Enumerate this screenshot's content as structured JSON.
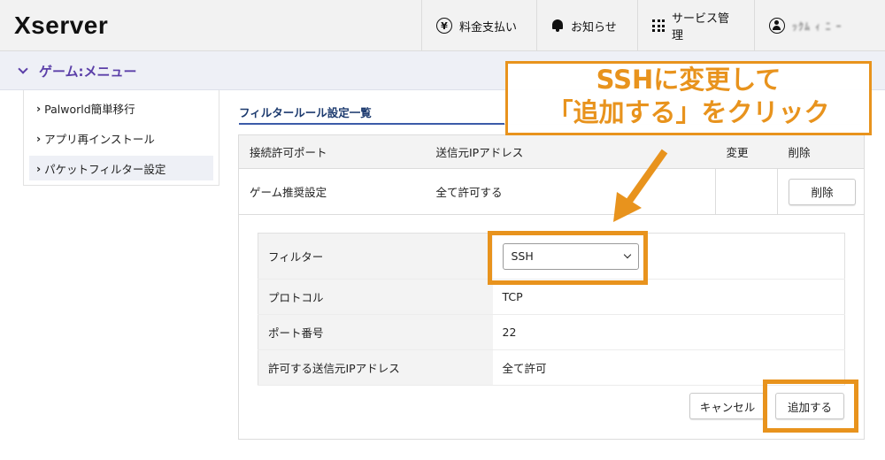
{
  "header": {
    "logo": "Xserver",
    "nav": [
      {
        "label": "料金支払い",
        "icon": "yen-icon"
      },
      {
        "label": "お知らせ",
        "icon": "bell-icon"
      },
      {
        "label": "サービス管理",
        "icon": "grid-icon"
      },
      {
        "label": "ｯｸﾑ ｨ ﾆ ｰ",
        "icon": "user-icon"
      }
    ]
  },
  "menubar": {
    "title": "ゲーム:メニュー"
  },
  "sidebar": {
    "items": [
      {
        "label": "Palworld簡単移行"
      },
      {
        "label": "アプリ再インストール"
      },
      {
        "label": "パケットフィルター設定",
        "active": true
      }
    ]
  },
  "content": {
    "title": "フィルタールール設定一覧",
    "table": {
      "headers": [
        "接続許可ポート",
        "送信元IPアドレス",
        "変更",
        "削除"
      ],
      "rows": [
        {
          "port": "ゲーム推奨設定",
          "source": "全て許可する",
          "delete_label": "削除"
        }
      ]
    },
    "form": {
      "filter_label": "フィルター",
      "filter_value": "SSH",
      "protocol_label": "プロトコル",
      "protocol_value": "TCP",
      "port_label": "ポート番号",
      "port_value": "22",
      "source_label": "許可する送信元IPアドレス",
      "source_value": "全て許可",
      "cancel_label": "キャンセル",
      "add_label": "追加する"
    }
  },
  "annotation": {
    "line1": "SSHに変更して",
    "line2": "「追加する」をクリック",
    "color": "#e8931d"
  }
}
